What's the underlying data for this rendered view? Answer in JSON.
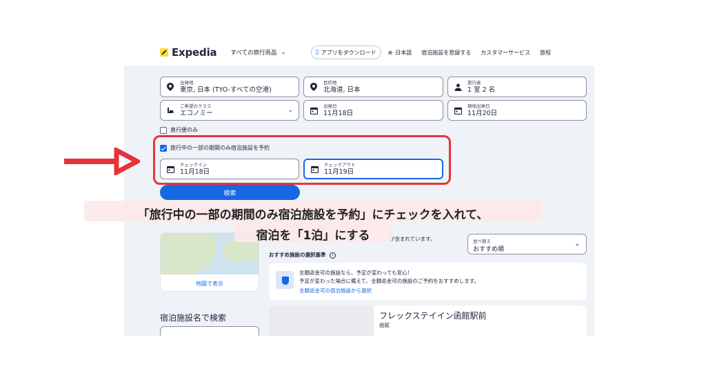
{
  "nav": {
    "logo": "Expedia",
    "all_products": "すべての旅行商品",
    "app_download": "アプリをダウンロード",
    "language": "日本語",
    "list_property": "宿泊施設を登録する",
    "customer_service": "カスタマーサービス",
    "trips": "旅程"
  },
  "search": {
    "origin_label": "出発地",
    "origin_value": "東京, 日本 (TYO-すべての空港)",
    "destination_label": "目的地",
    "destination_value": "北海道, 日本",
    "travelers_label": "旅行者",
    "travelers_value": "1 室 2 名",
    "class_label": "ご希望のクラス",
    "class_value": "エコノミー",
    "depart_label": "出発日",
    "depart_value": "11月18日",
    "return_label": "現地出発日",
    "return_value": "11月20日",
    "direct_only": "直行便のみ",
    "partial_stay": "旅行中の一部の期間のみ宿泊施設を予約",
    "checkin_label": "チェックイン",
    "checkin_value": "11月18日",
    "checkout_label": "チェックアウト",
    "checkout_value": "11月19日",
    "search_button": "検索"
  },
  "annotation": {
    "line1": "「旅行中の一部の期間のみ宿泊施設を予約」にチェックを入れて、",
    "line2": "宿泊を「1泊」にする"
  },
  "results": {
    "map_link": "地図で表示",
    "notice_suffix": "が含まれています。",
    "sort_label": "並べ替え",
    "sort_value": "おすすめ順",
    "criteria": "おすすめ施設の選択基準",
    "info_line1": "全額返金可の施設なら、予定が変わっても安心！",
    "info_line2": "予定が変わった場合に備えて、全額返金可の施設のご予約をおすすめします。",
    "info_link": "全額返金可の宿泊施設から選択",
    "hotel_name": "フレックステイイン函館駅前",
    "hotel_location": "函館",
    "property_search_title": "宿泊施設名で検索"
  },
  "colors": {
    "accent": "#1668e3",
    "annotation_red": "#e8323a",
    "logo_yellow": "#fddb32"
  }
}
